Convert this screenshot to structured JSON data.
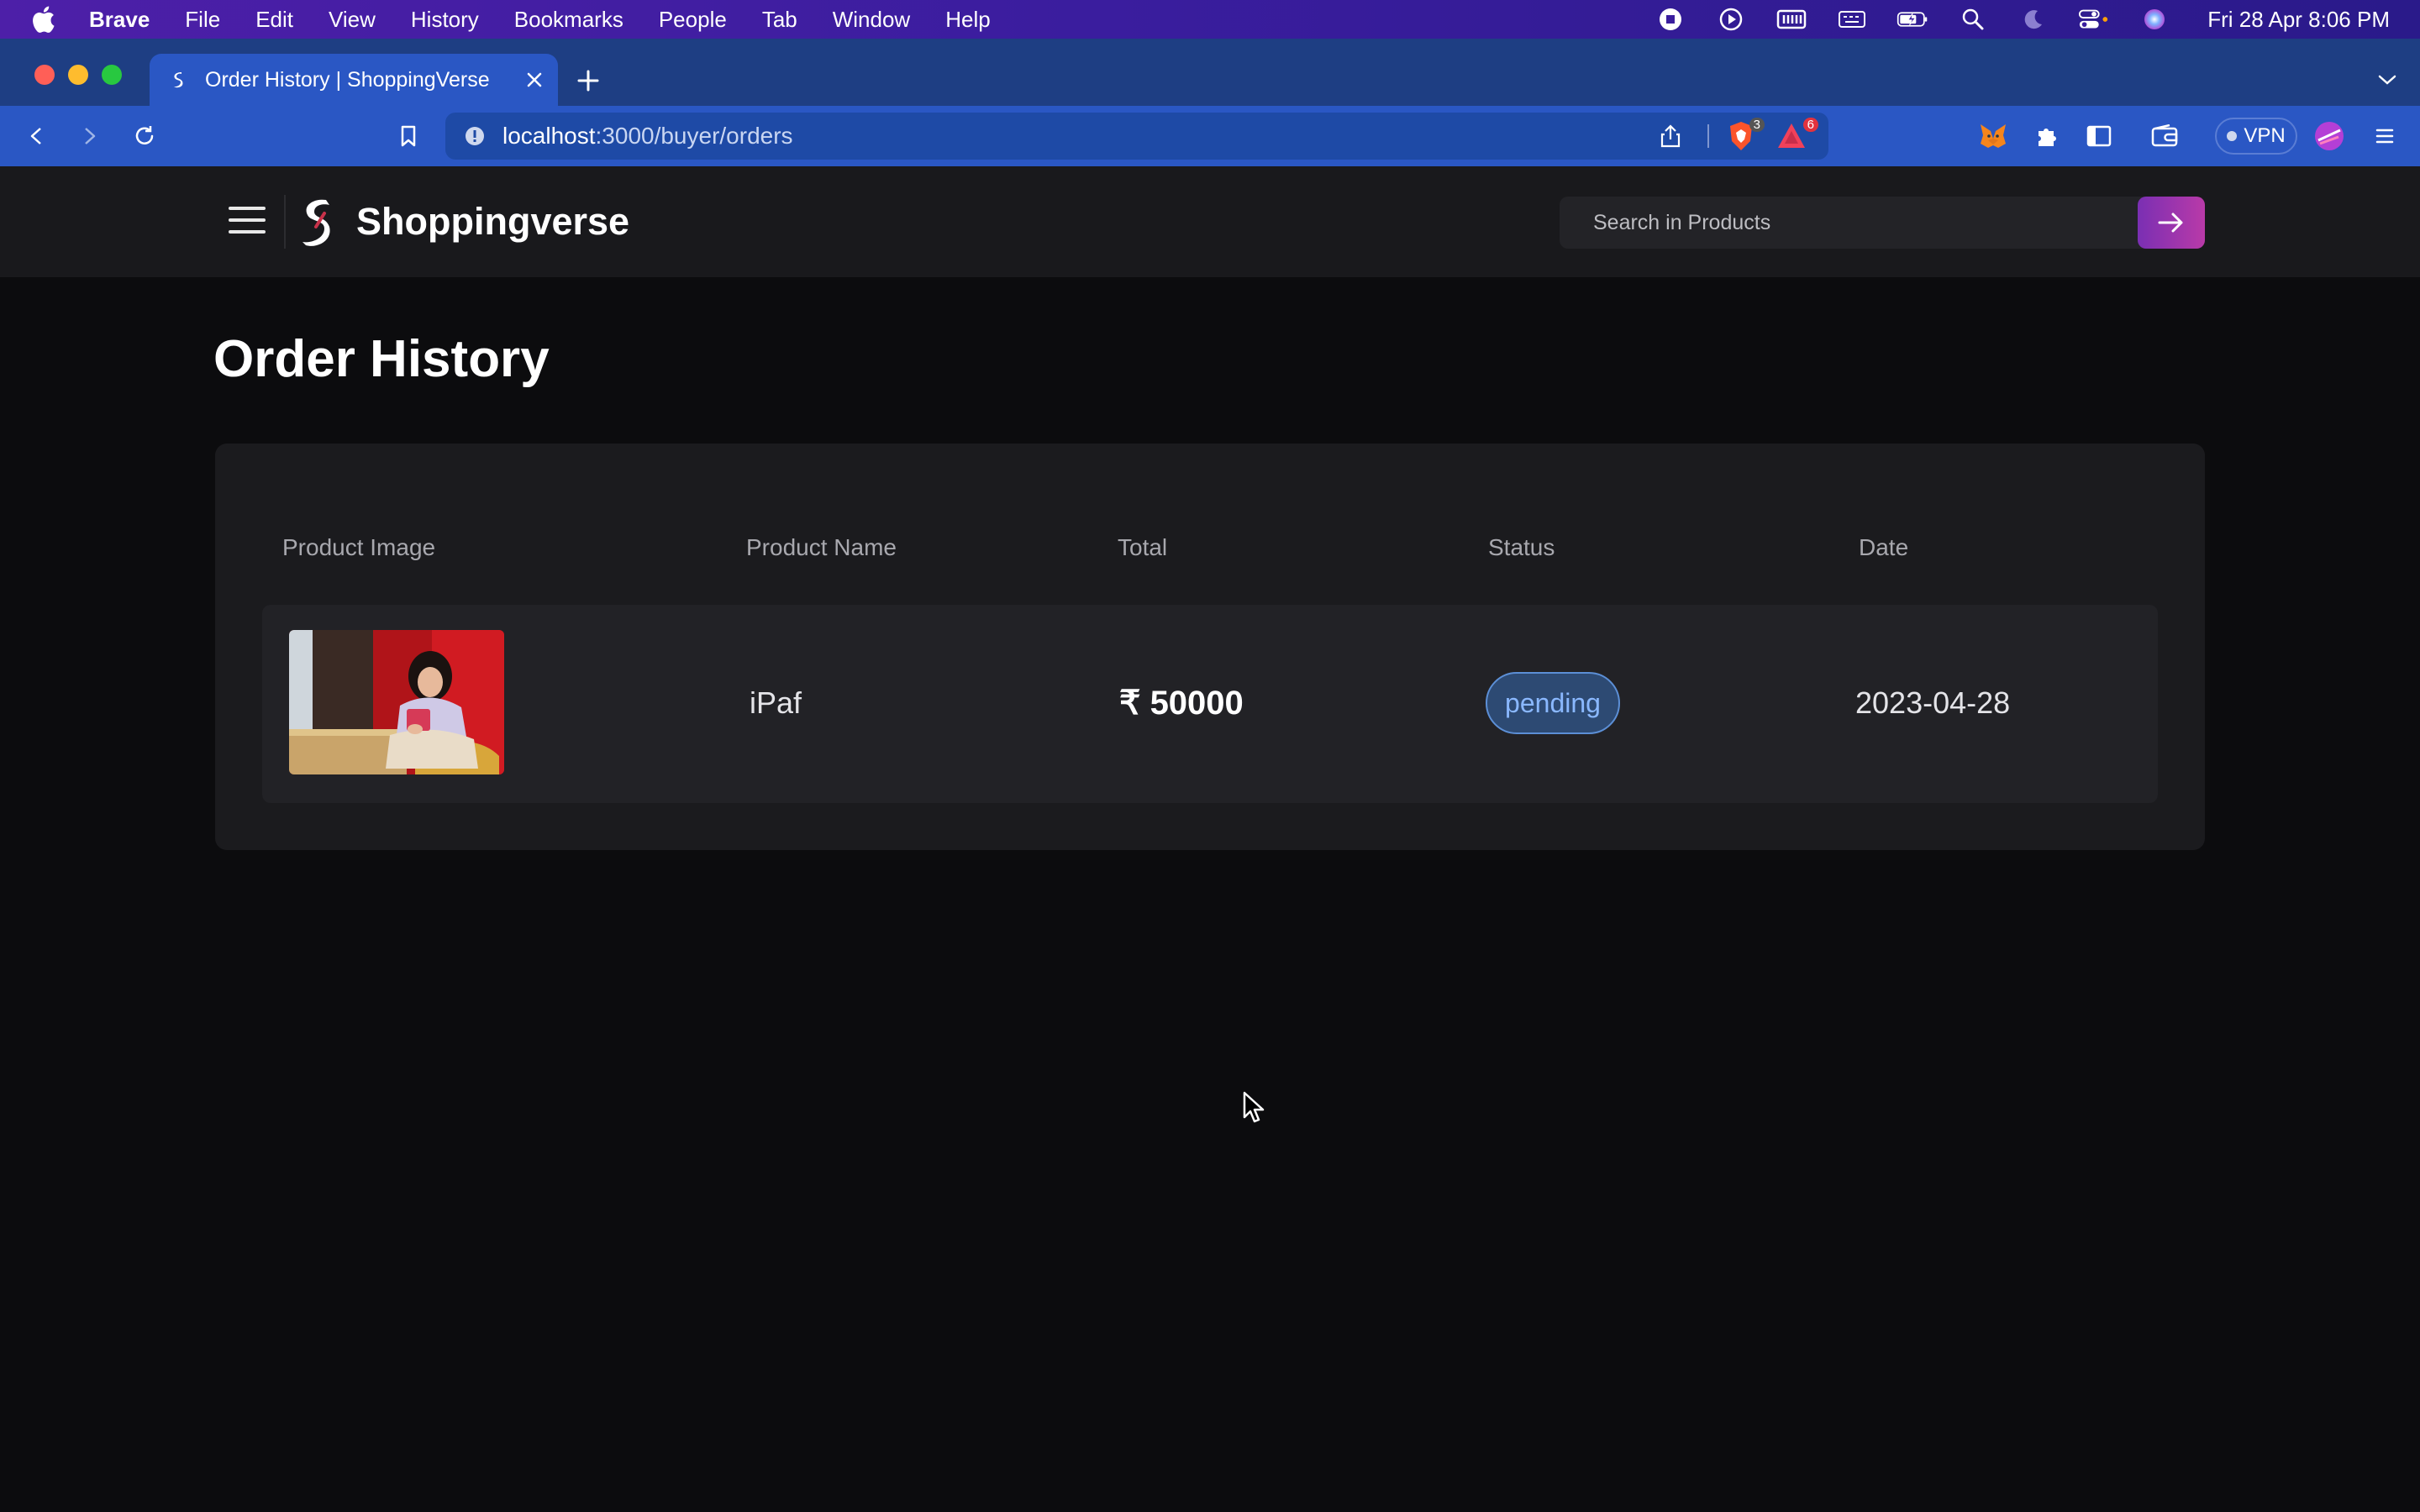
{
  "menubar": {
    "app_name": "Brave",
    "items": [
      "File",
      "Edit",
      "View",
      "History",
      "Bookmarks",
      "People",
      "Tab",
      "Window",
      "Help"
    ],
    "clock": "Fri 28 Apr  8:06 PM",
    "status_icons": [
      "stop-record-icon",
      "play-icon",
      "memory-icon",
      "keyboard-icon",
      "battery-charging-icon",
      "spotlight-search-icon",
      "moon-icon",
      "control-center-icon",
      "siri-icon"
    ]
  },
  "browser": {
    "tab_title": "Order History | ShoppingVerse",
    "url_host": "localhost",
    "url_path": ":3000/buyer/orders",
    "shield_badge": "3",
    "rewards_badge": "6",
    "vpn_label": "VPN"
  },
  "site": {
    "brand": "Shoppingverse",
    "search_placeholder": "Search in Products"
  },
  "orders": {
    "title": "Order History",
    "columns": [
      "Product Image",
      "Product Name",
      "Total",
      "Status",
      "Date"
    ],
    "rows": [
      {
        "name": "iPaf",
        "total": "₹ 50000",
        "status": "pending",
        "date": "2023-04-28"
      }
    ]
  },
  "colors": {
    "menubar": "#3a1d9e",
    "tabstrip": "#1e3e83",
    "toolbar": "#2a57c4",
    "page_bg": "#0c0c0e",
    "accent_gradient_start": "#7a2fb3",
    "accent_gradient_end": "#b93aa8",
    "status_pending": "#8ab8ff"
  }
}
